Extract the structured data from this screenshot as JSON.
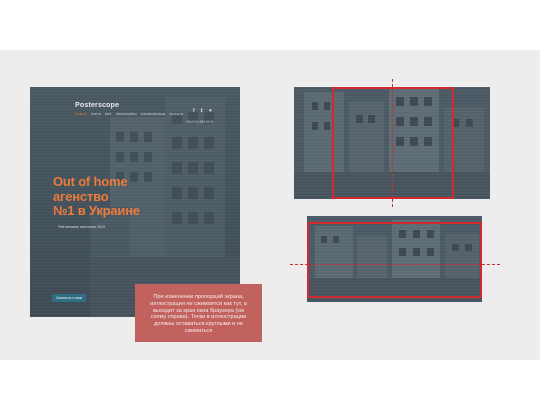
{
  "mockup": {
    "logo": "Posterscope",
    "nav": [
      "Главная",
      "Услуги",
      "Блог",
      "Работы/Кейсы",
      "Инновационные",
      "Контакты"
    ],
    "social": [
      "f",
      "𝕥",
      "♥"
    ],
    "phone": "+38 (044) 593 54 01",
    "headline": [
      "Out of home",
      "агенство",
      "№1 в Украине"
    ],
    "subline": "Рейтинговое агентство 2019",
    "cta": "Связаться с нами"
  },
  "note": {
    "text": "При изменении пропорций экрана, иллюстрация не сжимается как тут, а выходит за края окна браузера (см схему справа). Точки в иллюстрации должны оставаться круглыми и не сжиматься"
  },
  "colors": {
    "accent": "#ec7b3c",
    "frame": "#d12a2f",
    "note_bg": "#c2625f",
    "photo": "#4a5964"
  }
}
